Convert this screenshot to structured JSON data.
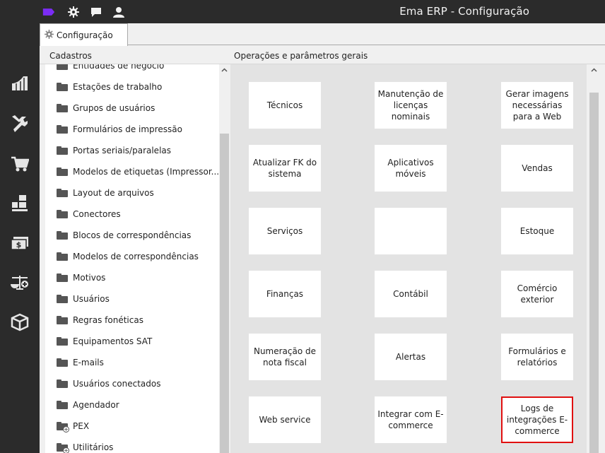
{
  "app": {
    "title": "Ema ERP - Configuração"
  },
  "topbar": {
    "icons": [
      "tag-icon",
      "gear-icon",
      "chat-icon",
      "user-icon"
    ],
    "accent": "#7b2cf5"
  },
  "sidebar": {
    "icons": [
      "dashboard-icon",
      "tools-icon",
      "cart-icon",
      "boxes-icon",
      "money-icon",
      "scale-icon",
      "package-icon"
    ]
  },
  "tabs": [
    {
      "label": "Configuração",
      "icon": "gear-icon"
    }
  ],
  "cadastros": {
    "header": "Cadastros",
    "items": [
      {
        "label": "Entidades de negócio",
        "expandable": false
      },
      {
        "label": "Estações de trabalho",
        "expandable": false
      },
      {
        "label": "Grupos de usuários",
        "expandable": false
      },
      {
        "label": "Formulários de impressão",
        "expandable": false
      },
      {
        "label": "Portas seriais/paralelas",
        "expandable": false
      },
      {
        "label": "Modelos de etiquetas (Impressor...",
        "expandable": false
      },
      {
        "label": "Layout de arquivos",
        "expandable": false
      },
      {
        "label": "Conectores",
        "expandable": false
      },
      {
        "label": "Blocos de correspondências",
        "expandable": false
      },
      {
        "label": "Modelos de correspondências",
        "expandable": false
      },
      {
        "label": "Motivos",
        "expandable": false
      },
      {
        "label": "Usuários",
        "expandable": false
      },
      {
        "label": "Regras fonéticas",
        "expandable": false
      },
      {
        "label": "Equipamentos SAT",
        "expandable": false
      },
      {
        "label": "E-mails",
        "expandable": false
      },
      {
        "label": "Usuários conectados",
        "expandable": false
      },
      {
        "label": "Agendador",
        "expandable": false
      },
      {
        "label": "PEX",
        "expandable": true
      },
      {
        "label": "Utilitários",
        "expandable": true
      }
    ]
  },
  "operacoes": {
    "header": "Operações e parâmetros gerais",
    "buttons": [
      {
        "label": "Técnicos"
      },
      {
        "label": "Manutenção de licenças nominais"
      },
      {
        "label": "Gerar imagens necessárias para a Web"
      },
      {
        "label": "Atualizar FK do sistema"
      },
      {
        "label": "Aplicativos móveis"
      },
      {
        "label": "Vendas"
      },
      {
        "label": "Serviços"
      },
      {
        "label": ""
      },
      {
        "label": "Estoque"
      },
      {
        "label": "Finanças"
      },
      {
        "label": "Contábil"
      },
      {
        "label": "Comércio exterior"
      },
      {
        "label": "Numeração de nota fiscal"
      },
      {
        "label": "Alertas"
      },
      {
        "label": "Formulários e relatórios"
      },
      {
        "label": "Web service"
      },
      {
        "label": "Integrar com E-commerce"
      },
      {
        "label": "Logs de integrações E-commerce",
        "selected": true
      }
    ]
  }
}
